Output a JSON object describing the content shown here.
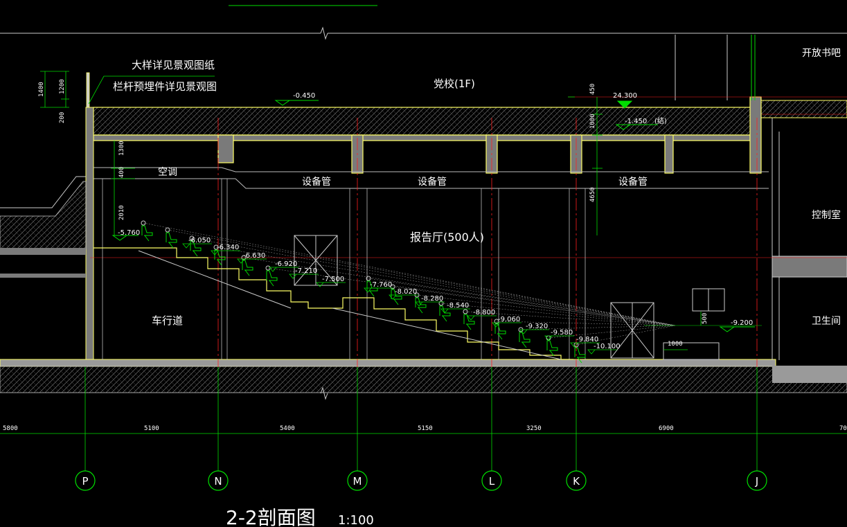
{
  "drawing": {
    "title": "2-2剖面图",
    "scale": "1:100",
    "top_note_line1": "大样详见景观图纸",
    "top_note_line2": "栏杆预埋件详见景观图"
  },
  "rooms": {
    "party_school": "党校(1F)",
    "open_bar": "开放书吧",
    "hall": "报告厅(500人)",
    "control_room": "控制室",
    "restroom": "卫生间",
    "driveway": "车行道",
    "ac": "空调",
    "pipe1": "设备管",
    "pipe2": "设备管",
    "pipe3": "设备管"
  },
  "elevations": {
    "e1": "-0.450",
    "e2": "24.300",
    "e3": "-1.450",
    "e3_note": "(结)",
    "e_start": "-5.760",
    "e_end": "-9.200",
    "steps": [
      "-6.050",
      "-6.340",
      "-6.630",
      "-6.920",
      "-7.210",
      "-7.500",
      "-7.760",
      "-8.020",
      "-8.280",
      "-8.540",
      "-8.800",
      "-9.060",
      "-9.320",
      "-9.580",
      "-9.840",
      "-10.100"
    ]
  },
  "dims": {
    "left_1400": "1400",
    "left_1200": "1200",
    "left_200": "200",
    "d1300": "1300",
    "d400": "400",
    "d2010": "2010",
    "d450": "450",
    "d1000": "1000",
    "d4650": "4650",
    "d500": "500",
    "d_stage": "1000"
  },
  "axis_spacing": [
    "5800",
    "5100",
    "5400",
    "5150",
    "3250",
    "6900",
    "70"
  ],
  "axes": [
    "P",
    "N",
    "M",
    "L",
    "K",
    "J"
  ],
  "colors": {
    "wall": "#ffff66",
    "grid_red": "#ff2020",
    "dim_green": "#00dd00",
    "hatch": "#7a7a7a",
    "text": "#ffffff",
    "axis_green": "#00e000"
  }
}
